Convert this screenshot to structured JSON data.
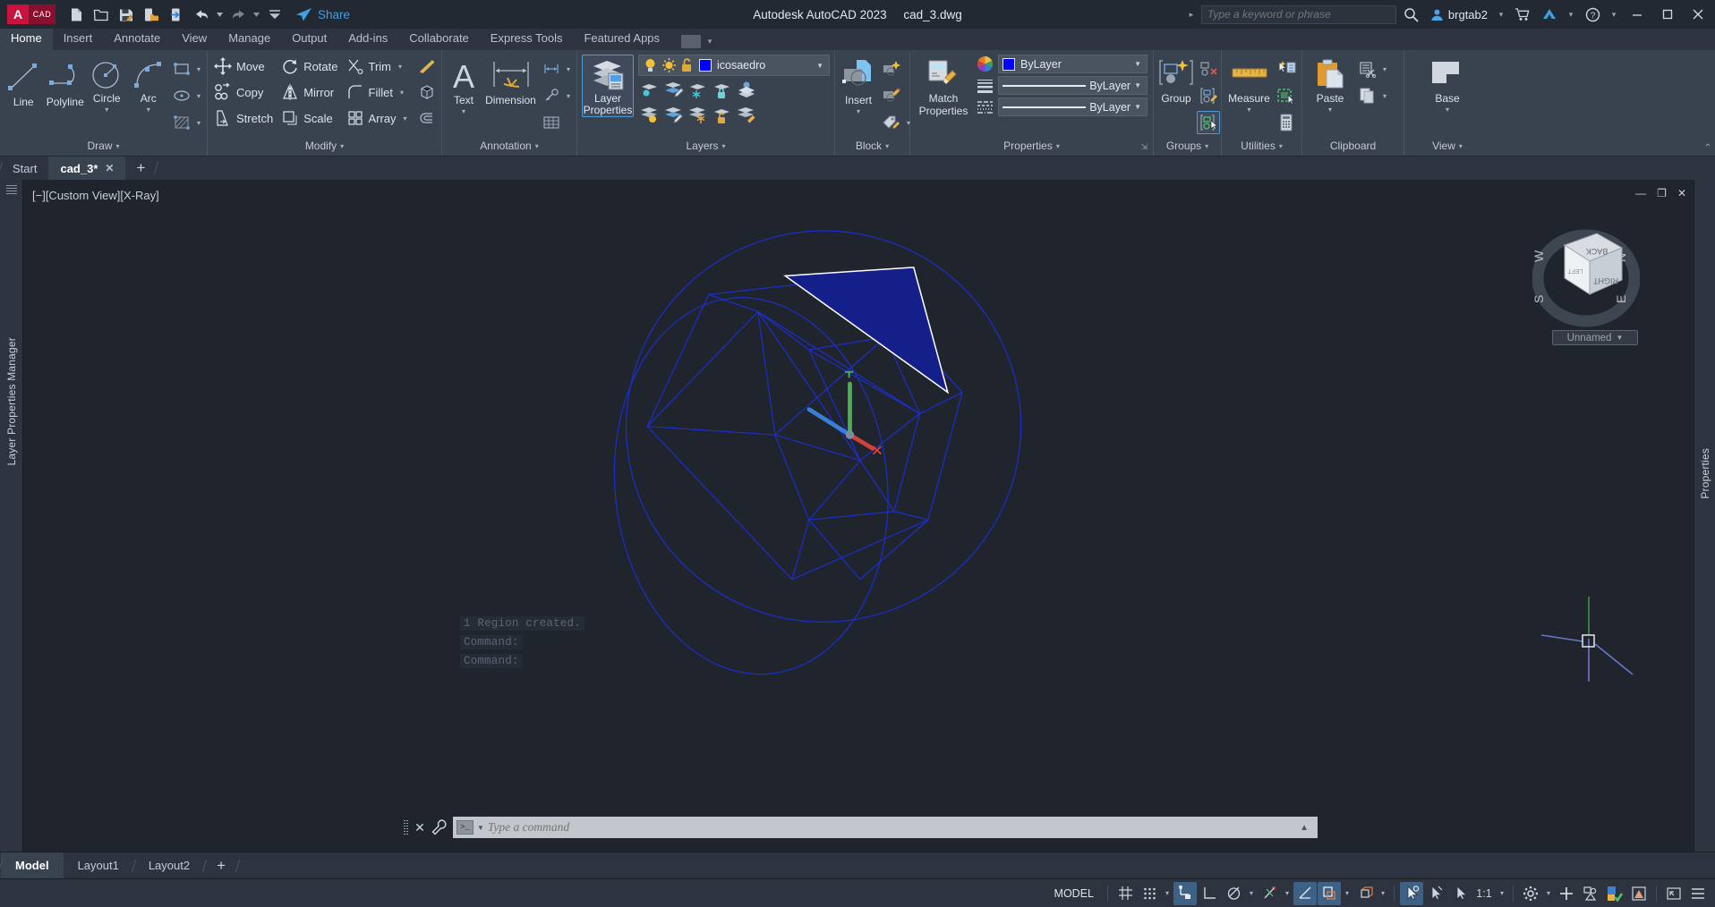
{
  "titlebar": {
    "app_title": "Autodesk AutoCAD 2023",
    "file_name": "cad_3.dwg",
    "logo_a": "A",
    "logo_cad": "CAD",
    "share_label": "Share",
    "search_placeholder": "Type a keyword or phrase",
    "user_name": "brgtab2",
    "quick_access": [
      {
        "name": "new-file-icon",
        "title": "New"
      },
      {
        "name": "open-file-icon",
        "title": "Open"
      },
      {
        "name": "save-icon",
        "title": "Save"
      },
      {
        "name": "save-as-icon",
        "title": "Save As"
      },
      {
        "name": "plot-icon",
        "title": "Plot"
      },
      {
        "name": "undo-icon",
        "title": "Undo"
      },
      {
        "name": "redo-icon",
        "title": "Redo"
      },
      {
        "name": "qat-more-icon",
        "title": "Customize"
      }
    ],
    "window_buttons": [
      "minimize",
      "restore",
      "close"
    ]
  },
  "ribbon_tabs": [
    {
      "label": "Home",
      "active": true
    },
    {
      "label": "Insert",
      "active": false
    },
    {
      "label": "Annotate",
      "active": false
    },
    {
      "label": "View",
      "active": false
    },
    {
      "label": "Manage",
      "active": false
    },
    {
      "label": "Output",
      "active": false
    },
    {
      "label": "Add-ins",
      "active": false
    },
    {
      "label": "Collaborate",
      "active": false
    },
    {
      "label": "Express Tools",
      "active": false
    },
    {
      "label": "Featured Apps",
      "active": false
    }
  ],
  "ribbon": {
    "draw": {
      "title": "Draw",
      "big": [
        {
          "label": "Line",
          "icon": "line-icon"
        },
        {
          "label": "Polyline",
          "icon": "polyline-icon"
        },
        {
          "label": "Circle",
          "icon": "circle-icon",
          "has_caret": true
        },
        {
          "label": "Arc",
          "icon": "arc-icon",
          "has_caret": true
        }
      ],
      "small": [
        {
          "name": "rectangle-icon"
        },
        {
          "name": "ellipse-icon"
        },
        {
          "name": "hatch-icon"
        }
      ]
    },
    "modify": {
      "title": "Modify",
      "rows": [
        [
          {
            "label": "Move",
            "icon": "move-icon"
          },
          {
            "label": "Rotate",
            "icon": "rotate-icon"
          },
          {
            "label": "Trim",
            "icon": "trim-icon",
            "has_caret": true
          },
          {
            "label": "",
            "icon": "erase-brush-icon"
          }
        ],
        [
          {
            "label": "Copy",
            "icon": "copy-icon"
          },
          {
            "label": "Mirror",
            "icon": "mirror-icon"
          },
          {
            "label": "Fillet",
            "icon": "fillet-icon",
            "has_caret": true
          },
          {
            "label": "",
            "icon": "solid-edit-icon"
          }
        ],
        [
          {
            "label": "Stretch",
            "icon": "stretch-icon"
          },
          {
            "label": "Scale",
            "icon": "scale-icon"
          },
          {
            "label": "Array",
            "icon": "array-icon",
            "has_caret": true
          },
          {
            "label": "",
            "icon": "offset-icon"
          }
        ]
      ]
    },
    "annotation": {
      "title": "Annotation",
      "big": [
        {
          "label": "Text",
          "icon": "text-icon",
          "has_caret": true
        },
        {
          "label": "Dimension",
          "icon": "dimension-icon"
        }
      ],
      "small": [
        {
          "name": "dim-linear-icon"
        },
        {
          "name": "leader-icon"
        },
        {
          "name": "table-icon"
        }
      ]
    },
    "layers": {
      "title": "Layers",
      "layer_properties_label": "Layer\nProperties",
      "layer_properties_line1": "Layer",
      "layer_properties_line2": "Properties",
      "current_layer": "icosaedro",
      "layer_color_hex": "#0000ff",
      "state_icons": [
        "lightbulb-on-icon",
        "sun-icon",
        "unlock-icon"
      ],
      "tool_icons_row1": [
        "layer-isolate-icon",
        "layer-unisolate-icon",
        "layer-freeze-icon",
        "layer-lock-icon",
        "layer-turn-off-icon"
      ],
      "tool_icons_row2": [
        "layer-on-icon",
        "layer-thaw-icon",
        "layer-off-icon",
        "layer-unlock-icon",
        "layer-match-icon"
      ]
    },
    "block": {
      "title": "Block",
      "insert_label": "Insert",
      "small": [
        "create-block-icon",
        "edit-block-icon",
        "edit-attribute-icon"
      ]
    },
    "properties": {
      "title": "Properties",
      "color": {
        "label": "ByLayer",
        "icon": "color-wheel-icon",
        "swatch_hex": "#0000ff"
      },
      "linewidth": {
        "label": "ByLayer",
        "icon": "lineweight-icon"
      },
      "linetype": {
        "label": "ByLayer",
        "icon": "linetype-icon"
      },
      "match_properties_line1": "Match",
      "match_properties_line2": "Properties"
    },
    "groups": {
      "title": "Groups",
      "group_label": "Group",
      "small": [
        "ungroup-icon",
        "group-edit-icon",
        "group-selection-on-icon"
      ]
    },
    "utilities": {
      "title": "Utilities",
      "measure_label": "Measure",
      "small": [
        "quick-select-icon",
        "quick-calc-select-icon",
        "calculator-icon"
      ]
    },
    "clipboard": {
      "title": "Clipboard",
      "paste_label": "Paste",
      "small": [
        "cut-icon",
        "copy-clip-icon"
      ]
    },
    "view": {
      "title": "View",
      "base_label": "Base"
    }
  },
  "doc_tabs": {
    "tabs": [
      {
        "label": "Start",
        "active": false,
        "closable": false
      },
      {
        "label": "cad_3*",
        "active": true,
        "closable": true
      }
    ],
    "add_label": "+"
  },
  "left_panel": {
    "title": "Layer Properties Manager"
  },
  "right_panel": {
    "title": "Properties"
  },
  "viewport": {
    "label": "[−][Custom View][X-Ray]",
    "background_hex": "#1f242d",
    "view_name": "Unnamed",
    "window_controls": [
      "minimize",
      "restore",
      "close"
    ],
    "command_history": [
      "1 Region created.",
      "Command:",
      "Command:"
    ],
    "command_placeholder": "Type a command",
    "viewcube_faces": [
      "BACK",
      "RIGHT",
      "LEFT"
    ],
    "compass": [
      "N",
      "E",
      "S",
      "W"
    ],
    "geometry": {
      "wire_color_hex": "#1b2fd0",
      "highlight_face_hex": "#151f8a",
      "highlight_edge_hex": "#ffffff",
      "ucs_x_hex": "#d2413c",
      "ucs_y_hex": "#4caf50",
      "ucs_z_hex": "#3a7fd5"
    }
  },
  "layout_tabs": {
    "tabs": [
      {
        "label": "Model",
        "active": true
      },
      {
        "label": "Layout1",
        "active": false
      },
      {
        "label": "Layout2",
        "active": false
      }
    ],
    "add_label": "+"
  },
  "statusbar": {
    "space_label": "MODEL",
    "scale": "1:1",
    "buttons": [
      {
        "name": "grid-display-icon",
        "on": false,
        "caret": false
      },
      {
        "name": "snap-mode-icon",
        "on": false,
        "caret": true
      },
      {
        "name": "infer-constraints-icon",
        "on": true,
        "caret": false
      },
      {
        "name": "ortho-mode-icon",
        "on": false,
        "caret": false
      },
      {
        "name": "polar-tracking-icon",
        "on": false,
        "caret": true
      },
      {
        "name": "object-snap-tracking-icon",
        "on": false,
        "caret": true
      },
      {
        "name": "object-snap-icon",
        "on": true,
        "caret": false
      },
      {
        "name": "lineweight-display-icon",
        "on": true,
        "caret": true
      },
      {
        "name": "transparency-icon",
        "on": false,
        "caret": true
      },
      {
        "name": "selection-cycling-icon",
        "on": true,
        "caret": false
      },
      {
        "name": "3d-object-snap-icon",
        "on": false,
        "caret": false
      },
      {
        "name": "dynamic-ucs-icon",
        "on": false,
        "caret": false
      },
      {
        "name": "annotation-scale-label",
        "on": false,
        "caret": true
      },
      {
        "name": "workspace-gear-icon",
        "on": false,
        "caret": true
      },
      {
        "name": "hardware-acceleration-icon",
        "on": false,
        "caret": false
      },
      {
        "name": "isolate-objects-icon",
        "on": false,
        "caret": false
      },
      {
        "name": "graphics-performance-icon",
        "on": false,
        "caret": false
      },
      {
        "name": "clean-screen-icon",
        "on": false,
        "caret": false
      },
      {
        "name": "fullscreen-icon",
        "on": false,
        "caret": false
      },
      {
        "name": "customization-icon",
        "on": false,
        "caret": false
      }
    ]
  }
}
